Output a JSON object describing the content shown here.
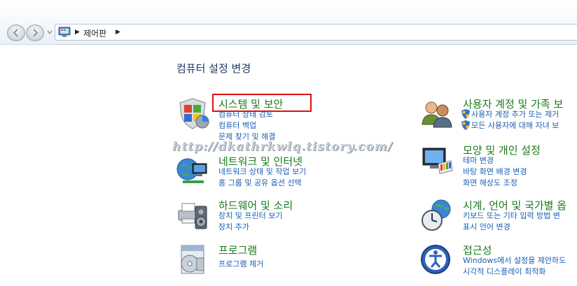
{
  "address": {
    "location": "제어판"
  },
  "heading": "컴퓨터 설정 변경",
  "categories_left": [
    {
      "title": "시스템 및 보안",
      "icon": "shield-flag-icon",
      "links": [
        "컴퓨터 상태 검토",
        "컴퓨터 백업",
        "문제 찾기 및 해결"
      ]
    },
    {
      "title": "네트워크 및 인터넷",
      "icon": "network-globe-icon",
      "links": [
        "네트워크 상태 및 작업 보기",
        "홈 그룹 및 공유 옵션 선택"
      ]
    },
    {
      "title": "하드웨어 및 소리",
      "icon": "printer-speaker-icon",
      "links": [
        "장치 및 프린터 보기",
        "장치 추가"
      ]
    },
    {
      "title": "프로그램",
      "icon": "programs-disc-icon",
      "links": [
        "프로그램 제거"
      ]
    }
  ],
  "categories_right": [
    {
      "title": "사용자 계정 및 가족 보",
      "icon": "users-icon",
      "links": [
        "사용자 계정 추가 또는 제거",
        "모든 사용자에 대해 자녀 보"
      ],
      "link_shields": [
        true,
        true
      ]
    },
    {
      "title": "모양 및 개인 설정",
      "icon": "monitor-palette-icon",
      "links": [
        "테마 변경",
        "바탕 화면 배경 변경",
        "화면 해상도 조정"
      ]
    },
    {
      "title": "시계, 언어 및 국가별 옵",
      "icon": "clock-globe-icon",
      "links": [
        "키보드 또는 기타 입력 방법 변",
        "표시 언어 변경"
      ]
    },
    {
      "title": "접근성",
      "icon": "ease-of-access-icon",
      "links": [
        "Windows에서 설정을 제안하도",
        "시각적 디스플레이 최적화"
      ]
    }
  ],
  "watermark": "http://dkathrkwlq.tistory.com/",
  "colors": {
    "category_title": "#1a7a1a",
    "link": "#1a5fb4",
    "heading": "#1e3a66",
    "highlight": "#e01010"
  }
}
